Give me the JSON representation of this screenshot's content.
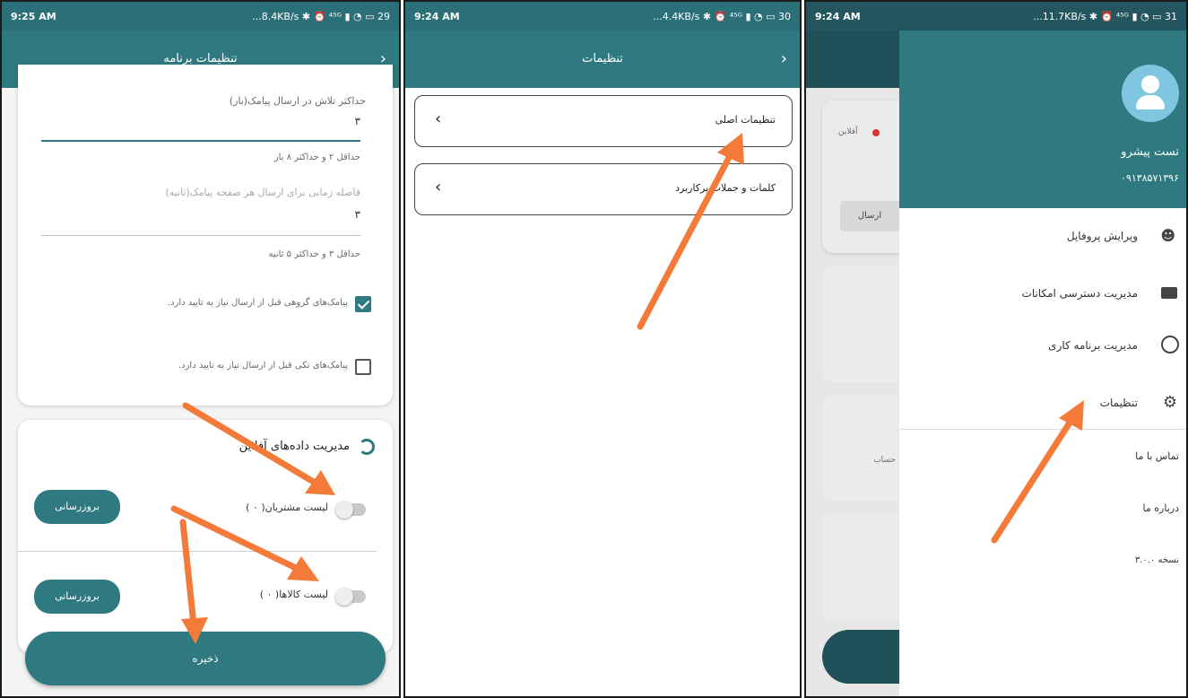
{
  "colors": {
    "primary": "#2f7a80",
    "status_bar": "#2b6f78",
    "arrow": "#f47a3a"
  },
  "screen1": {
    "status": {
      "time": "9:25 AM",
      "indicators": "...8.4KB/s ✱ ⏰ ⁴⁵ᴳ ▮ ◔ ▭ 29"
    },
    "toolbar": {
      "title": "تنظیمات برنامه"
    },
    "field1": {
      "label": "حداکثر تلاش در ارسال پیامک(بار)",
      "value": "۳",
      "helper": "حداقل ۲ و حداکثر ۸ بار"
    },
    "field2": {
      "placeholder": "فاصله زمانی برای ارسال هر صفحه پیامک(ثانیه)",
      "value": "۳",
      "helper": "حداقل ۳ و حداکثر ۵ ثانیه"
    },
    "check1": {
      "label": "پیامک‌های گروهی قبل از ارسال نیاز به تایید دارد."
    },
    "check2": {
      "label": "پیامک‌های تکی قبل از ارسال نیاز به تایید دارد."
    },
    "offline": {
      "title": "مدیریت داده‌های آفلاین",
      "customers_label": "لیست مشتریان( ۰ )",
      "products_label": "لیست کالاها( ۰ )",
      "update_label": "بروزرسانی"
    },
    "save_label": "ذخیره"
  },
  "screen2": {
    "status": {
      "time": "9:24 AM",
      "indicators": "...4.4KB/s ✱ ⏰ ⁴⁵ᴳ ▮ ◔ ▭ 30"
    },
    "toolbar": {
      "title": "تنظیمات"
    },
    "items": [
      {
        "label": "تنظیمات اصلی"
      },
      {
        "label": "کلمات و جملات پرکاربرد"
      }
    ]
  },
  "screen3": {
    "status": {
      "time": "9:24 AM",
      "indicators": "...11.7KB/s ✱ ⏰ ⁴⁵ᴳ ▮ ◔ ▭ 31"
    },
    "background": {
      "status_chip": "آفلاین",
      "send_button": "ارسال",
      "report_label": "حساب"
    },
    "drawer": {
      "user_name": "تست پیشرو",
      "phone": "۰۹۱۳۸۵۷۱۳۹۶",
      "menu": [
        {
          "label": "ویرایش پروفایل",
          "icon": "person-icon"
        },
        {
          "label": "مدیریت دسترسی امکانات",
          "icon": "briefcase-icon"
        },
        {
          "label": "مدیریت برنامه کاری",
          "icon": "clock-icon"
        },
        {
          "label": "تنظیمات",
          "icon": "gear-icon"
        }
      ],
      "links": [
        {
          "label": "تماس با ما"
        },
        {
          "label": "درباره ما"
        },
        {
          "label": "نسخه ۳.۰.۰"
        }
      ]
    }
  }
}
